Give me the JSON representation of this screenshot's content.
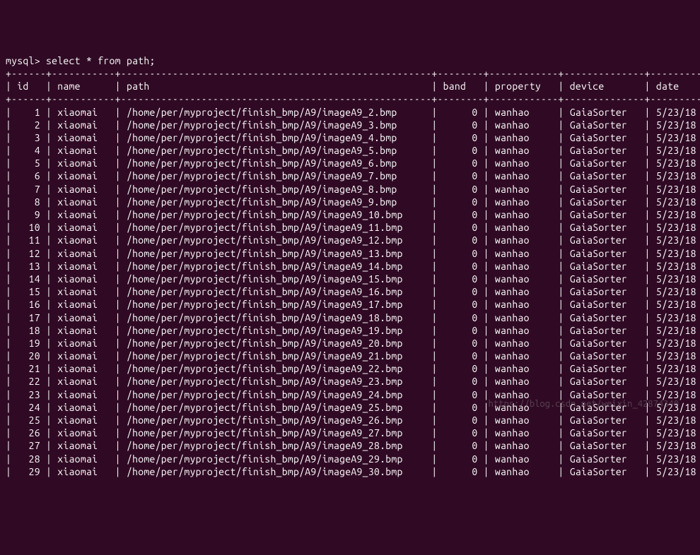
{
  "prompt": "mysql> ",
  "query": "select * from path;",
  "columns": [
    "id",
    "name",
    "path",
    "band",
    "property",
    "device",
    "date"
  ],
  "rows": [
    {
      "id": 1,
      "name": "xiaomai",
      "path": "/home/per/myproject/finish_bmp/A9/imageA9_2.bmp",
      "band": 0,
      "property": "wanhao",
      "device": "GaiaSorter",
      "date": "5/23/18"
    },
    {
      "id": 2,
      "name": "xiaomai",
      "path": "/home/per/myproject/finish_bmp/A9/imageA9_3.bmp",
      "band": 0,
      "property": "wanhao",
      "device": "GaiaSorter",
      "date": "5/23/18"
    },
    {
      "id": 3,
      "name": "xiaomai",
      "path": "/home/per/myproject/finish_bmp/A9/imageA9_4.bmp",
      "band": 0,
      "property": "wanhao",
      "device": "GaiaSorter",
      "date": "5/23/18"
    },
    {
      "id": 4,
      "name": "xiaomai",
      "path": "/home/per/myproject/finish_bmp/A9/imageA9_5.bmp",
      "band": 0,
      "property": "wanhao",
      "device": "GaiaSorter",
      "date": "5/23/18"
    },
    {
      "id": 5,
      "name": "xiaomai",
      "path": "/home/per/myproject/finish_bmp/A9/imageA9_6.bmp",
      "band": 0,
      "property": "wanhao",
      "device": "GaiaSorter",
      "date": "5/23/18"
    },
    {
      "id": 6,
      "name": "xiaomai",
      "path": "/home/per/myproject/finish_bmp/A9/imageA9_7.bmp",
      "band": 0,
      "property": "wanhao",
      "device": "GaiaSorter",
      "date": "5/23/18"
    },
    {
      "id": 7,
      "name": "xiaomai",
      "path": "/home/per/myproject/finish_bmp/A9/imageA9_8.bmp",
      "band": 0,
      "property": "wanhao",
      "device": "GaiaSorter",
      "date": "5/23/18"
    },
    {
      "id": 8,
      "name": "xiaomai",
      "path": "/home/per/myproject/finish_bmp/A9/imageA9_9.bmp",
      "band": 0,
      "property": "wanhao",
      "device": "GaiaSorter",
      "date": "5/23/18"
    },
    {
      "id": 9,
      "name": "xiaomai",
      "path": "/home/per/myproject/finish_bmp/A9/imageA9_10.bmp",
      "band": 0,
      "property": "wanhao",
      "device": "GaiaSorter",
      "date": "5/23/18"
    },
    {
      "id": 10,
      "name": "xiaomai",
      "path": "/home/per/myproject/finish_bmp/A9/imageA9_11.bmp",
      "band": 0,
      "property": "wanhao",
      "device": "GaiaSorter",
      "date": "5/23/18"
    },
    {
      "id": 11,
      "name": "xiaomai",
      "path": "/home/per/myproject/finish_bmp/A9/imageA9_12.bmp",
      "band": 0,
      "property": "wanhao",
      "device": "GaiaSorter",
      "date": "5/23/18"
    },
    {
      "id": 12,
      "name": "xiaomai",
      "path": "/home/per/myproject/finish_bmp/A9/imageA9_13.bmp",
      "band": 0,
      "property": "wanhao",
      "device": "GaiaSorter",
      "date": "5/23/18"
    },
    {
      "id": 13,
      "name": "xiaomai",
      "path": "/home/per/myproject/finish_bmp/A9/imageA9_14.bmp",
      "band": 0,
      "property": "wanhao",
      "device": "GaiaSorter",
      "date": "5/23/18"
    },
    {
      "id": 14,
      "name": "xiaomai",
      "path": "/home/per/myproject/finish_bmp/A9/imageA9_15.bmp",
      "band": 0,
      "property": "wanhao",
      "device": "GaiaSorter",
      "date": "5/23/18"
    },
    {
      "id": 15,
      "name": "xiaomai",
      "path": "/home/per/myproject/finish_bmp/A9/imageA9_16.bmp",
      "band": 0,
      "property": "wanhao",
      "device": "GaiaSorter",
      "date": "5/23/18"
    },
    {
      "id": 16,
      "name": "xiaomai",
      "path": "/home/per/myproject/finish_bmp/A9/imageA9_17.bmp",
      "band": 0,
      "property": "wanhao",
      "device": "GaiaSorter",
      "date": "5/23/18"
    },
    {
      "id": 17,
      "name": "xiaomai",
      "path": "/home/per/myproject/finish_bmp/A9/imageA9_18.bmp",
      "band": 0,
      "property": "wanhao",
      "device": "GaiaSorter",
      "date": "5/23/18"
    },
    {
      "id": 18,
      "name": "xiaomai",
      "path": "/home/per/myproject/finish_bmp/A9/imageA9_19.bmp",
      "band": 0,
      "property": "wanhao",
      "device": "GaiaSorter",
      "date": "5/23/18"
    },
    {
      "id": 19,
      "name": "xiaomai",
      "path": "/home/per/myproject/finish_bmp/A9/imageA9_20.bmp",
      "band": 0,
      "property": "wanhao",
      "device": "GaiaSorter",
      "date": "5/23/18"
    },
    {
      "id": 20,
      "name": "xiaomai",
      "path": "/home/per/myproject/finish_bmp/A9/imageA9_21.bmp",
      "band": 0,
      "property": "wanhao",
      "device": "GaiaSorter",
      "date": "5/23/18"
    },
    {
      "id": 21,
      "name": "xiaomai",
      "path": "/home/per/myproject/finish_bmp/A9/imageA9_22.bmp",
      "band": 0,
      "property": "wanhao",
      "device": "GaiaSorter",
      "date": "5/23/18"
    },
    {
      "id": 22,
      "name": "xiaomai",
      "path": "/home/per/myproject/finish_bmp/A9/imageA9_23.bmp",
      "band": 0,
      "property": "wanhao",
      "device": "GaiaSorter",
      "date": "5/23/18"
    },
    {
      "id": 23,
      "name": "xiaomai",
      "path": "/home/per/myproject/finish_bmp/A9/imageA9_24.bmp",
      "band": 0,
      "property": "wanhao",
      "device": "GaiaSorter",
      "date": "5/23/18"
    },
    {
      "id": 24,
      "name": "xiaomai",
      "path": "/home/per/myproject/finish_bmp/A9/imageA9_25.bmp",
      "band": 0,
      "property": "wanhao",
      "device": "GaiaSorter",
      "date": "5/23/18"
    },
    {
      "id": 25,
      "name": "xiaomai",
      "path": "/home/per/myproject/finish_bmp/A9/imageA9_26.bmp",
      "band": 0,
      "property": "wanhao",
      "device": "GaiaSorter",
      "date": "5/23/18"
    },
    {
      "id": 26,
      "name": "xiaomai",
      "path": "/home/per/myproject/finish_bmp/A9/imageA9_27.bmp",
      "band": 0,
      "property": "wanhao",
      "device": "GaiaSorter",
      "date": "5/23/18"
    },
    {
      "id": 27,
      "name": "xiaomai",
      "path": "/home/per/myproject/finish_bmp/A9/imageA9_28.bmp",
      "band": 0,
      "property": "wanhao",
      "device": "GaiaSorter",
      "date": "5/23/18"
    },
    {
      "id": 28,
      "name": "xiaomai",
      "path": "/home/per/myproject/finish_bmp/A9/imageA9_29.bmp",
      "band": 0,
      "property": "wanhao",
      "device": "GaiaSorter",
      "date": "5/23/18"
    },
    {
      "id": 29,
      "name": "xiaomai",
      "path": "/home/per/myproject/finish_bmp/A9/imageA9_30.bmp",
      "band": 0,
      "property": "wanhao",
      "device": "GaiaSorter",
      "date": "5/23/18"
    }
  ],
  "watermark": "https://blog.csdn.net/weixin_42874340",
  "col_widths": {
    "id": 4,
    "name": 9,
    "path": 52,
    "band": 6,
    "property": 10,
    "device": 12,
    "date": 9
  }
}
